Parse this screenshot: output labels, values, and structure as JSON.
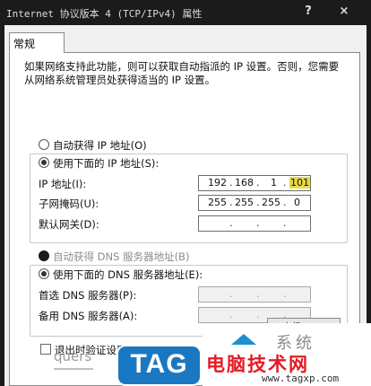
{
  "window": {
    "title": "Internet 协议版本 4 (TCP/IPv4) 属性",
    "help_glyph": "?",
    "close_glyph": "×"
  },
  "tabs": [
    {
      "label": "常规"
    }
  ],
  "description": "如果网络支持此功能，则可以获取自动指派的 IP 设置。否则，您需要从网络系统管理员处获得适当的 IP 设置。",
  "ip_section": {
    "auto_label": "自动获得 IP 地址(O)",
    "manual_label": "使用下面的 IP 地址(S):",
    "fields": [
      {
        "label": "IP 地址(I):",
        "octets": [
          "192",
          "168",
          "1",
          "101"
        ]
      },
      {
        "label": "子网掩码(U):",
        "octets": [
          "255",
          "255",
          "255",
          "0"
        ]
      },
      {
        "label": "默认网关(D):",
        "octets": [
          "",
          "",
          "",
          ""
        ]
      }
    ]
  },
  "dns_section": {
    "auto_label": "自动获得 DNS 服务器地址(B)",
    "manual_label": "使用下面的 DNS 服务器地址(E):",
    "fields": [
      {
        "label": "首选 DNS 服务器(P):",
        "octets": [
          "",
          "",
          "",
          ""
        ]
      },
      {
        "label": "备用 DNS 服务器(A):",
        "octets": [
          "",
          "",
          "",
          ""
        ]
      }
    ]
  },
  "validate_label": "退出时验证设置(L)",
  "advanced_label": "高级(V)...",
  "watermarks": {
    "queris": "quers",
    "tag": "TAG",
    "system": "系统",
    "brand": "电脑技术网",
    "url": "www.tagxp.com"
  },
  "colors": {
    "titlebar": "#1b1b1b",
    "dialog_bg": "#f0f0f0",
    "highlight": "#e8d84a",
    "tag_blue": "#1a78c2",
    "brand_red": "#e41b24"
  }
}
